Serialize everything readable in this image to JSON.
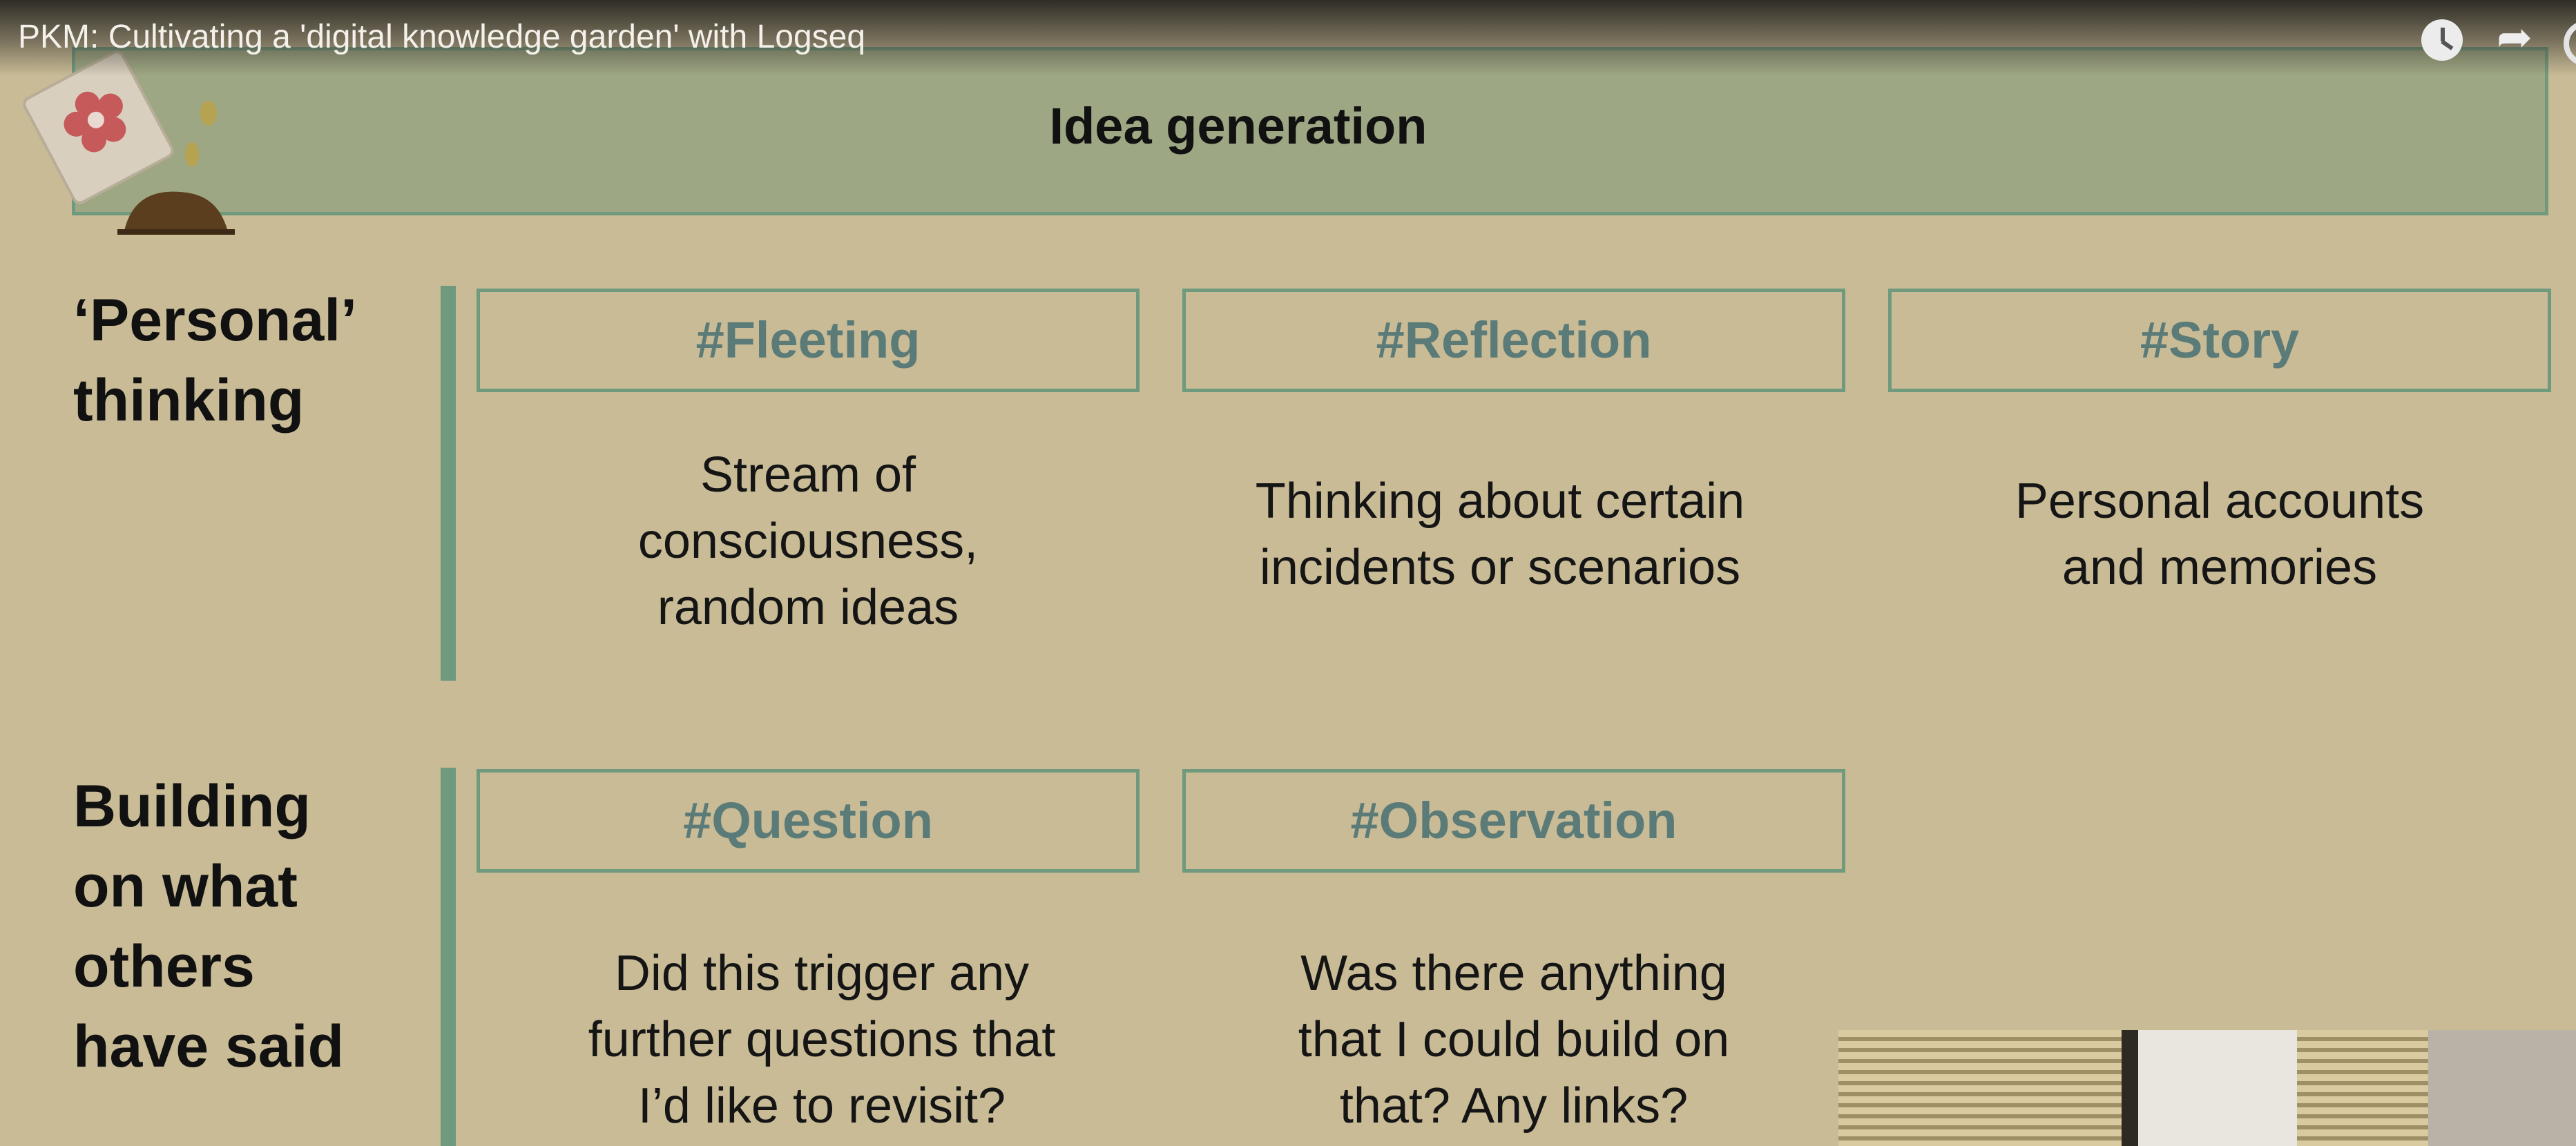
{
  "video": {
    "title": "PKM: Cultivating a 'digital knowledge garden' with Logseq"
  },
  "icons": {
    "watch_later": "clock-icon",
    "share": "share-arrow-icon",
    "logo": "seed-packet-icon"
  },
  "slide": {
    "header": "Idea generation",
    "rows": [
      {
        "label_lines": [
          "‘Personal’",
          "thinking"
        ],
        "cards": [
          {
            "tag": "#Fleeting",
            "desc_lines": [
              "Stream of",
              "consciousness,",
              "random ideas"
            ]
          },
          {
            "tag": "#Reflection",
            "desc_lines": [
              "Thinking about certain",
              "incidents or scenarios"
            ]
          },
          {
            "tag": "#Story",
            "desc_lines": [
              "Personal accounts",
              "and memories"
            ]
          }
        ]
      },
      {
        "label_lines": [
          "Building",
          "on what",
          "others",
          "have said"
        ],
        "cards": [
          {
            "tag": "#Question",
            "desc_lines": [
              "Did this trigger any",
              "further questions that",
              "I’d like to revisit?"
            ]
          },
          {
            "tag": "#Observation",
            "desc_lines": [
              "Was there anything",
              "that I could build on",
              "that? Any links?"
            ]
          }
        ]
      }
    ]
  },
  "colors": {
    "background": "#c8bb96",
    "header_fill": "#9ea783",
    "accent_green": "#6f9a7e",
    "tag_text": "#5b7b78"
  }
}
